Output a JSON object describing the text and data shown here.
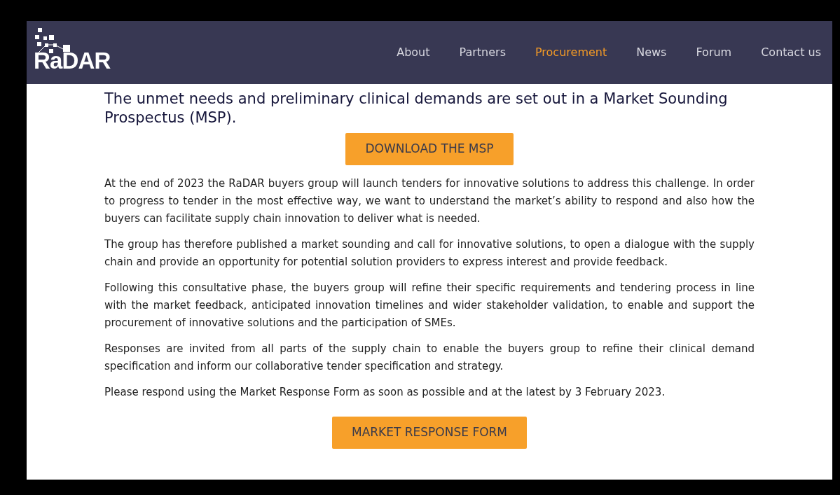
{
  "header": {
    "logo": "RaDAR",
    "nav": [
      {
        "label": "About",
        "selected": false
      },
      {
        "label": "Partners",
        "selected": false
      },
      {
        "label": "Procurement",
        "selected": true
      },
      {
        "label": "News",
        "selected": false
      },
      {
        "label": "Forum",
        "selected": false
      },
      {
        "label": "Contact us",
        "selected": false
      }
    ]
  },
  "heading": "The unmet needs and preliminary clinical demands are set out in a Market Sounding Prospectus (MSP).",
  "download_button": "DOWNLOAD THE MSP",
  "paragraphs": [
    "At the end of 2023 the RaDAR buyers group will launch tenders for innovative solutions to address this challenge. In order to progress to tender in the most effective way, we want to understand the market’s ability to respond and also how the buyers can facilitate supply chain innovation to deliver what is needed.",
    "The group has therefore published a market sounding and call for innovative solutions, to open a dialogue with the supply chain and provide an opportunity for potential solution providers to express interest and provide feedback.",
    "Following this consultative phase, the buyers group will refine their specific requirements and tendering process in line with the market feedback, anticipated innovation timelines and wider stakeholder validation, to enable and support the procurement of innovative solutions and the participation of SMEs.",
    "Responses are invited from all parts of the supply chain to enable the buyers group to refine their clinical demand specification and inform our collaborative tender specification and strategy.",
    "Please respond using the Market Response Form as soon as possible and at the latest by 3 February 2023."
  ],
  "response_button": "MARKET RESPONSE FORM"
}
